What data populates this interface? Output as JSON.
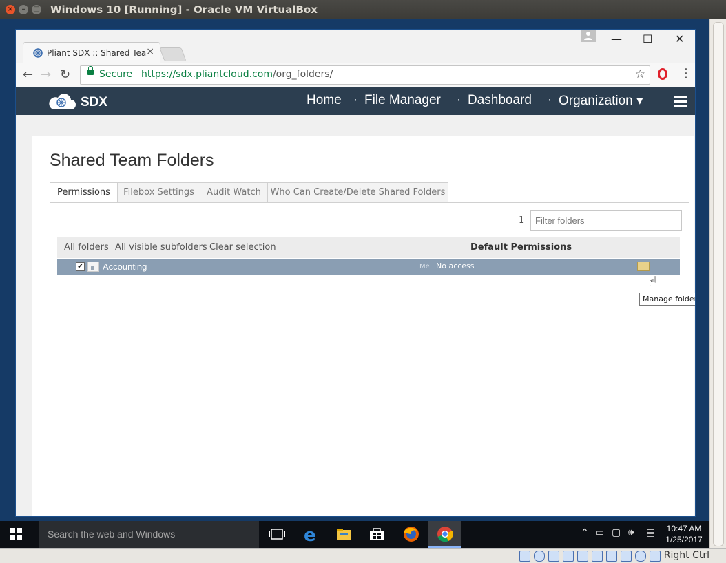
{
  "vm_window": {
    "title": "Windows 10 [Running] - Oracle VM VirtualBox",
    "status_right": "Right Ctrl"
  },
  "browser": {
    "tab_title": "Pliant SDX :: Shared Team Folders",
    "tab_close": "×",
    "secure_label": "Secure",
    "url_host": "https://sdx.pliantcloud.com",
    "url_path": "/org_folders/",
    "star": "☆",
    "menu": "⋮",
    "back": "←",
    "forward": "→",
    "reload": "↻",
    "win_min": "—",
    "win_max": "☐",
    "win_close": "✕"
  },
  "site": {
    "logo_text": "SDX",
    "nav": {
      "home": "Home",
      "file_manager": "File Manager",
      "dashboard": "Dashboard",
      "organization": "Organization ▾",
      "separator": "·"
    },
    "page_title": "Shared Team Folders",
    "tabs": [
      {
        "label": "Permissions",
        "active": true
      },
      {
        "label": "Filebox Settings",
        "active": false
      },
      {
        "label": "Audit Watch",
        "active": false
      },
      {
        "label": "Who Can Create/Delete Shared Folders",
        "active": false
      }
    ],
    "folder_count": "1",
    "filter_placeholder": "Filter folders",
    "list_header": {
      "all_folders": "All folders",
      "all_visible_subfolders": "All visible subfolders",
      "clear_selection": "Clear selection",
      "default_permissions": "Default Permissions"
    },
    "rows": [
      {
        "checked": true,
        "checkmark": "✔",
        "name": "Accounting",
        "owner": "Me",
        "access": "No access"
      }
    ],
    "tooltip": "Manage folder permissions"
  },
  "taskbar": {
    "search_placeholder": "Search the web and Windows",
    "time": "10:47 AM",
    "date": "1/25/2017"
  },
  "colors": {
    "navbar": "#2c3e50",
    "row_selected": "#8a9eb3",
    "secure_green": "#0b8043",
    "taskbar": "#0c0f14"
  }
}
